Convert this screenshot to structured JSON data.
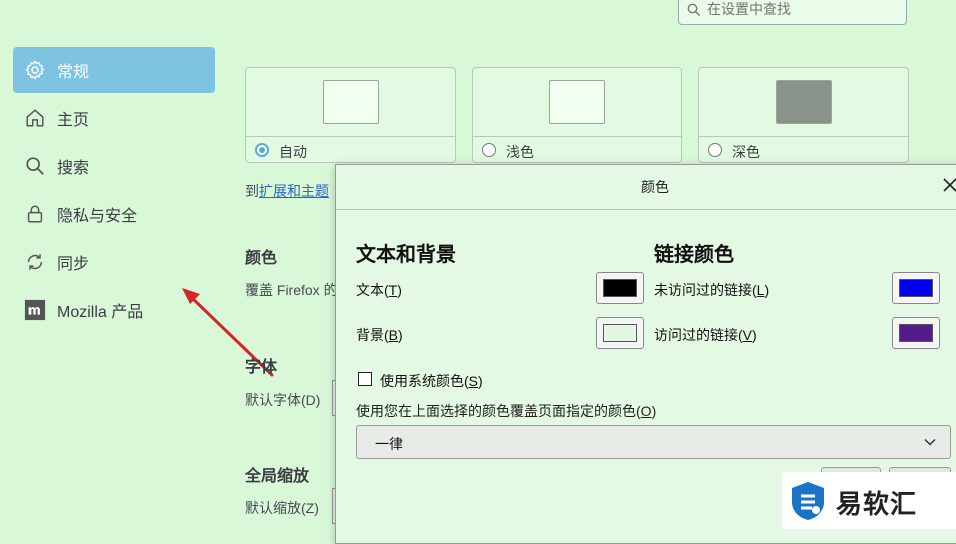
{
  "search": {
    "placeholder": "在设置中查找"
  },
  "sidebar": {
    "items": [
      {
        "label": "常规",
        "icon": "gear-icon",
        "active": true
      },
      {
        "label": "主页",
        "icon": "home-icon"
      },
      {
        "label": "搜索",
        "icon": "search-icon"
      },
      {
        "label": "隐私与安全",
        "icon": "lock-icon"
      },
      {
        "label": "同步",
        "icon": "sync-icon"
      },
      {
        "label": "Mozilla 产品",
        "icon": "mozilla-icon"
      }
    ]
  },
  "themes": {
    "options": [
      {
        "label": "自动",
        "selected": true
      },
      {
        "label": "浅色",
        "selected": false
      },
      {
        "label": "深色",
        "selected": false
      }
    ],
    "link_prefix": "到",
    "link_text": "扩展和主题"
  },
  "background": {
    "colors_heading": "颜色",
    "colors_desc": "覆盖 Firefox 的",
    "fonts_heading": "字体",
    "default_font_label": "默认字体(D)",
    "zoom_heading": "全局缩放",
    "default_zoom_label": "默认缩放(Z)"
  },
  "dialog": {
    "title": "颜色",
    "text_bg_heading": "文本和背景",
    "link_heading": "链接颜色",
    "text_label": "文本(",
    "text_key": "T",
    "bg_label": "背景(",
    "bg_key": "B",
    "unvisited_label": "未访问过的链接(",
    "unvisited_key": "L",
    "visited_label": "访问过的链接(",
    "visited_key": "V",
    "close_paren": ")",
    "use_system_label": "使用系统颜色(",
    "use_system_key": "S",
    "override_label": "使用您在上面选择的颜色覆盖页面指定的颜色(",
    "override_key": "O",
    "override_value": "一律",
    "use_system_checked": false,
    "colors": {
      "text": "#000000",
      "background": "#e4f7e4",
      "unvisited": "#0000ee",
      "visited": "#551a8b"
    }
  },
  "watermark": {
    "text": "易软汇"
  }
}
